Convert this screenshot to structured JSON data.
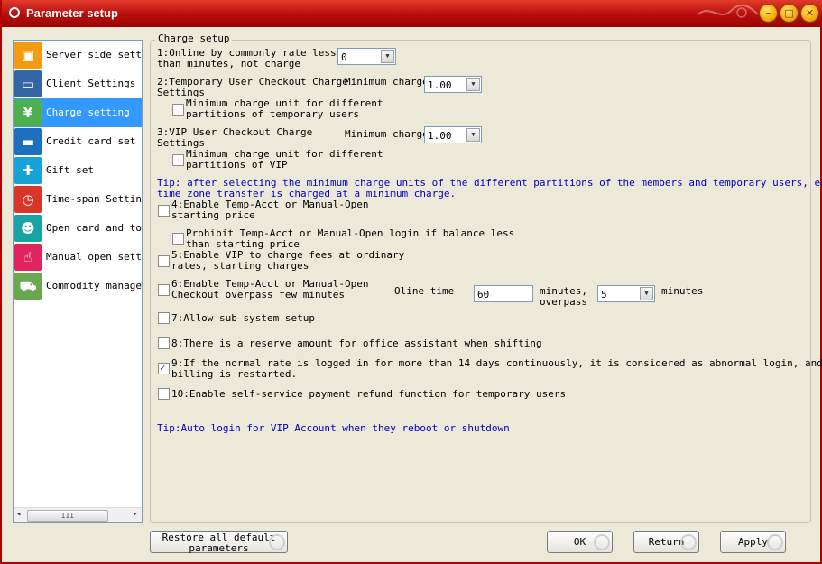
{
  "window": {
    "title": "Parameter setup",
    "minimize": "–",
    "maximize": "□",
    "close": "✕"
  },
  "sidebar": {
    "items": [
      {
        "label": "Server side settin",
        "icon": "server-icon",
        "color": "#f39c12",
        "glyph": "▣"
      },
      {
        "label": "Client Settings",
        "icon": "monitor-icon",
        "color": "#3465a4",
        "glyph": "▭"
      },
      {
        "label": "Charge setting",
        "icon": "charge-icon",
        "color": "#4caf50",
        "glyph": "¥"
      },
      {
        "label": "Credit card set",
        "icon": "credit-card-icon",
        "color": "#1f6fbf",
        "glyph": "▬"
      },
      {
        "label": "Gift set",
        "icon": "gift-icon",
        "color": "#17a2d8",
        "glyph": "✚"
      },
      {
        "label": "Time-span Setting",
        "icon": "clock-icon",
        "color": "#d9362b",
        "glyph": "◷"
      },
      {
        "label": "Open card and top",
        "icon": "id-card-icon",
        "color": "#1aa3a3",
        "glyph": "☻"
      },
      {
        "label": "Manual open settir",
        "icon": "hand-pointer-icon",
        "color": "#e0245e",
        "glyph": "☝"
      },
      {
        "label": "Commodity manageme",
        "icon": "cart-icon",
        "color": "#6aa84f",
        "glyph": "⛟"
      }
    ],
    "selected_index": 2,
    "scroll_left": "◂",
    "scroll_right": "▸",
    "scroll_thumb": "III"
  },
  "charge": {
    "group_title": "Charge setup",
    "online_label_1": "1:Online by commonly rate less",
    "online_label_2": "than    minutes, not charge",
    "online_value": "0",
    "temp_label_1": "2:Temporary User Checkout Charge",
    "temp_label_2": "Settings",
    "temp_min_label": "Minimum charge",
    "temp_min_value": "1.00",
    "temp_partition_1": "Minimum charge unit for different",
    "temp_partition_2": "partitions of temporary users",
    "vip_label_1": "3:VIP User Checkout Charge",
    "vip_label_2": "Settings",
    "vip_min_label": "Minimum charge",
    "vip_min_value": "1.00",
    "vip_partition_1": "Minimum charge unit for different",
    "vip_partition_2": "partitions of VIP",
    "tip1_line1": "Tip: after selecting the minimum charge units of the different partitions of the members and temporary users, each",
    "tip1_line2": "time zone transfer is charged at a minimum charge.",
    "opt4_1": "4:Enable Temp-Acct or Manual-Open",
    "opt4_2": "starting price",
    "prohibit_1": "Prohibit Temp-Acct or Manual-Open login if balance less",
    "prohibit_2": "than starting price",
    "opt5_1": "5:Enable VIP to charge fees at ordinary",
    "opt5_2": "rates, starting charges",
    "opt6_1": "6:Enable Temp-Acct or Manual-Open",
    "opt6_2": "Checkout overpass few minutes",
    "oline_label": "Oline time",
    "oline_value": "60",
    "minutes_overpass_1": "minutes,",
    "minutes_overpass_2": "overpass",
    "overpass_value": "5",
    "minutes_label": "minutes",
    "opt7": "7:Allow sub system setup",
    "opt8": "8:There is a reserve amount for office assistant when shifting",
    "opt9_1": "9:If the normal rate is logged in for more than 14 days continuously, it is considered as abnormal login, and the",
    "opt9_2": "billing is restarted.",
    "opt10": "10:Enable self-service payment refund function for temporary users",
    "tip2": "Tip:Auto login for VIP Account when they reboot or shutdown",
    "check_mark": "✓"
  },
  "buttons": {
    "restore_1": "Restore all default",
    "restore_2": "parameters",
    "ok": "OK",
    "return": "Return",
    "apply": "Apply"
  },
  "colors": {
    "title_bar": "#b60d0d",
    "selection": "#3399ff",
    "tip_text": "#0000c0"
  }
}
